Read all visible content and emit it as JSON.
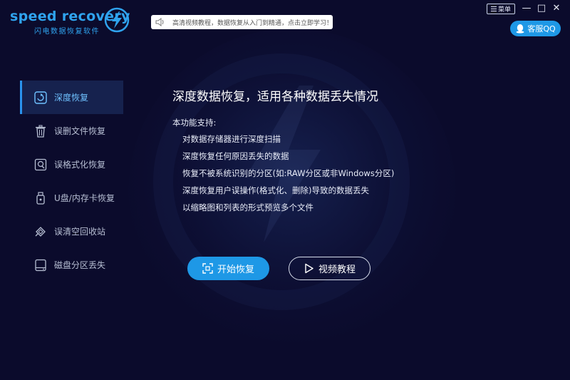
{
  "app": {
    "logo_text": "speed recovery",
    "logo_subtitle": "闪电数据恢复软件",
    "notice": "高清视频教程，数据恢复从入门到精通，点击立即学习！",
    "menu_label": "菜单",
    "minimize_glyph": "—",
    "maximize_glyph": "□",
    "close_glyph": "✕",
    "qq_label": "客服QQ"
  },
  "sidebar": {
    "items": [
      {
        "label": "深度恢复",
        "icon": "deep-recovery-icon",
        "active": true
      },
      {
        "label": "误删文件恢复",
        "icon": "trash-icon",
        "active": false
      },
      {
        "label": "误格式化恢复",
        "icon": "format-icon",
        "active": false
      },
      {
        "label": "U盘/内存卡恢复",
        "icon": "usb-icon",
        "active": false
      },
      {
        "label": "误清空回收站",
        "icon": "recycle-bin-icon",
        "active": false
      },
      {
        "label": "磁盘分区丢失",
        "icon": "disk-icon",
        "active": false
      }
    ]
  },
  "main": {
    "title": "深度数据恢复，适用各种数据丢失情况",
    "support_label": "本功能支持:",
    "features": [
      "对数据存储器进行深度扫描",
      "深度恢复任何原因丢失的数据",
      "恢复不被系统识别的分区(如:RAW分区或非Windows分区)",
      "深度恢复用户误操作(格式化、删除)导致的数据丢失",
      "以缩略图和列表的形式预览多个文件"
    ],
    "start_button": "开始恢复",
    "video_button": "视频教程"
  },
  "colors": {
    "background": "#0b0b2c",
    "accent": "#1e98e6",
    "sidebar_active": "#16224e",
    "active_text": "#6fc1ff"
  }
}
